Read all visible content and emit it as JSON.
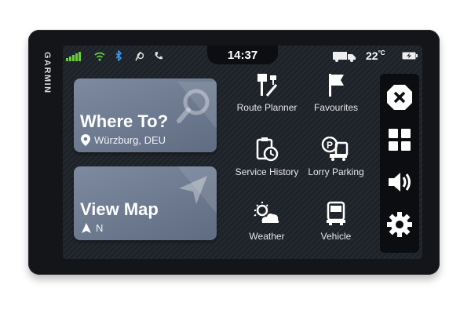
{
  "device": {
    "brand": "GARMIN"
  },
  "status": {
    "time": "14:37",
    "temperature": "22",
    "temp_unit": "°C",
    "icons": [
      "signal-icon",
      "wifi-icon",
      "bluetooth-icon",
      "voice-assist-icon",
      "phone-icon",
      "truck-icon",
      "battery-icon"
    ]
  },
  "cards": {
    "where_to": {
      "title": "Where To?",
      "location": "Würzburg, DEU"
    },
    "view_map": {
      "title": "View Map",
      "heading": "N"
    }
  },
  "apps": [
    {
      "label": "Route Planner",
      "icon": "route-planner-icon"
    },
    {
      "label": "Favourites",
      "icon": "flag-icon"
    },
    {
      "label": "Service History",
      "icon": "service-history-icon"
    },
    {
      "label": "Lorry Parking",
      "icon": "lorry-parking-icon"
    },
    {
      "label": "Weather",
      "icon": "weather-icon"
    },
    {
      "label": "Vehicle",
      "icon": "truck-icon"
    }
  ],
  "sidebar": [
    "close-icon",
    "apps-grid-icon",
    "volume-icon",
    "settings-icon"
  ],
  "colors": {
    "card": "#6e7b91",
    "screen": "#1d2128",
    "bezel": "#141518"
  }
}
